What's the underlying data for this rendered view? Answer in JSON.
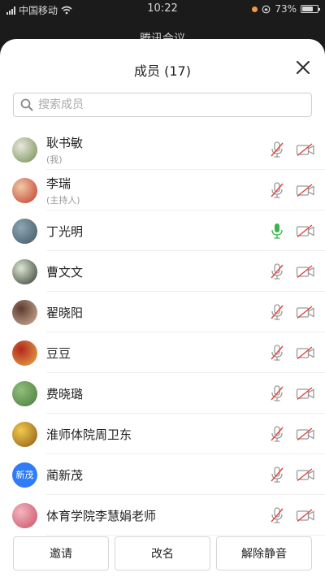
{
  "status_bar": {
    "carrier": "中国移动",
    "time": "10:22",
    "battery": "73%",
    "battery_level": 0.73
  },
  "background_title": "腾讯会议",
  "sheet": {
    "title": "成员 (17)",
    "search_placeholder": "搜索成员"
  },
  "members": [
    {
      "name": "耿书敏",
      "role": "(我)",
      "avatar_colors": [
        "#e9e6de",
        "#6f8e4c"
      ],
      "mic_on": false,
      "camera_on": false
    },
    {
      "name": "李瑞",
      "role": "(主持人)",
      "avatar_colors": [
        "#f0c9a6",
        "#c0392b"
      ],
      "mic_on": false,
      "camera_on": false
    },
    {
      "name": "丁光明",
      "role": "",
      "avatar_colors": [
        "#8fa7b3",
        "#3e5563"
      ],
      "mic_on": true,
      "camera_on": false
    },
    {
      "name": "曹文文",
      "role": "",
      "avatar_colors": [
        "#dfe7d4",
        "#2d3a2a"
      ],
      "mic_on": false,
      "camera_on": false
    },
    {
      "name": "翟晓阳",
      "role": "",
      "avatar_colors": [
        "#5a3b30",
        "#d6b49a"
      ],
      "mic_on": false,
      "camera_on": false
    },
    {
      "name": "豆豆",
      "role": "",
      "avatar_colors": [
        "#b3261e",
        "#e8b04a"
      ],
      "mic_on": false,
      "camera_on": false
    },
    {
      "name": "费晓璐",
      "role": "",
      "avatar_colors": [
        "#8fbf7a",
        "#4b7a3c"
      ],
      "mic_on": false,
      "camera_on": false
    },
    {
      "name": "淮师体院周卫东",
      "role": "",
      "avatar_colors": [
        "#f2c94c",
        "#8a5a17"
      ],
      "mic_on": false,
      "camera_on": false
    },
    {
      "name": "蔺新茂",
      "role": "",
      "avatar_text": "新茂",
      "avatar_colors": [
        "#2f7cf6",
        "#2f7cf6"
      ],
      "mic_on": false,
      "camera_on": false
    },
    {
      "name": "体育学院李慧娟老师",
      "role": "",
      "avatar_colors": [
        "#f3b6c0",
        "#c94f66"
      ],
      "mic_on": false,
      "camera_on": false
    }
  ],
  "buttons": {
    "invite": "邀请",
    "rename": "改名",
    "unmute": "解除静音"
  },
  "colors": {
    "mic_on": "#3ab54a",
    "muted_slash": "#e0443c",
    "icon_gray": "#9a9a9a"
  }
}
